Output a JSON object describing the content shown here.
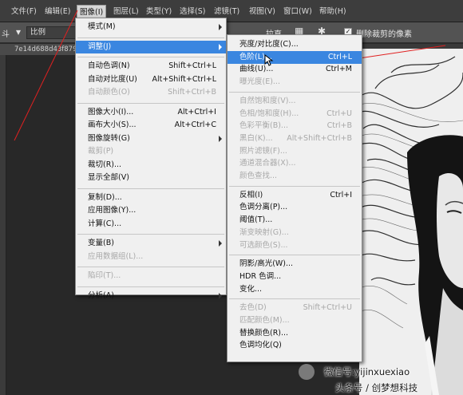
{
  "menubar": {
    "items": [
      "文件(F)",
      "编辑(E)",
      "图像(I)",
      "图层(L)",
      "类型(Y)",
      "选择(S)",
      "滤镜(T)",
      "视图(V)",
      "窗口(W)",
      "帮助(H)"
    ],
    "active_index": 2
  },
  "options": {
    "tool_label": "斗",
    "ratio_value": "比例",
    "straighten_label": "拉直",
    "delete_cropped_label": "删除裁剪的像素",
    "delete_cropped_checked": true
  },
  "tab": {
    "title": "7e14d688d43f879"
  },
  "image_menu": [
    {
      "type": "item",
      "label": "模式(M)",
      "shortcut": "",
      "submenu": true,
      "disabled": false,
      "highlighted": false
    },
    {
      "type": "sep"
    },
    {
      "type": "item",
      "label": "调整(J)",
      "shortcut": "",
      "submenu": true,
      "disabled": false,
      "highlighted": true
    },
    {
      "type": "sep"
    },
    {
      "type": "item",
      "label": "自动色调(N)",
      "shortcut": "Shift+Ctrl+L",
      "submenu": false,
      "disabled": false,
      "highlighted": false
    },
    {
      "type": "item",
      "label": "自动对比度(U)",
      "shortcut": "Alt+Shift+Ctrl+L",
      "submenu": false,
      "disabled": false,
      "highlighted": false
    },
    {
      "type": "item",
      "label": "自动颜色(O)",
      "shortcut": "Shift+Ctrl+B",
      "submenu": false,
      "disabled": true,
      "highlighted": false
    },
    {
      "type": "sep"
    },
    {
      "type": "item",
      "label": "图像大小(I)...",
      "shortcut": "Alt+Ctrl+I",
      "submenu": false,
      "disabled": false,
      "highlighted": false
    },
    {
      "type": "item",
      "label": "画布大小(S)...",
      "shortcut": "Alt+Ctrl+C",
      "submenu": false,
      "disabled": false,
      "highlighted": false
    },
    {
      "type": "item",
      "label": "图像旋转(G)",
      "shortcut": "",
      "submenu": true,
      "disabled": false,
      "highlighted": false
    },
    {
      "type": "item",
      "label": "裁剪(P)",
      "shortcut": "",
      "submenu": false,
      "disabled": true,
      "highlighted": false
    },
    {
      "type": "item",
      "label": "裁切(R)...",
      "shortcut": "",
      "submenu": false,
      "disabled": false,
      "highlighted": false
    },
    {
      "type": "item",
      "label": "显示全部(V)",
      "shortcut": "",
      "submenu": false,
      "disabled": false,
      "highlighted": false
    },
    {
      "type": "sep"
    },
    {
      "type": "item",
      "label": "复制(D)...",
      "shortcut": "",
      "submenu": false,
      "disabled": false,
      "highlighted": false
    },
    {
      "type": "item",
      "label": "应用图像(Y)...",
      "shortcut": "",
      "submenu": false,
      "disabled": false,
      "highlighted": false
    },
    {
      "type": "item",
      "label": "计算(C)...",
      "shortcut": "",
      "submenu": false,
      "disabled": false,
      "highlighted": false
    },
    {
      "type": "sep"
    },
    {
      "type": "item",
      "label": "变量(B)",
      "shortcut": "",
      "submenu": true,
      "disabled": false,
      "highlighted": false
    },
    {
      "type": "item",
      "label": "应用数据组(L)...",
      "shortcut": "",
      "submenu": false,
      "disabled": true,
      "highlighted": false
    },
    {
      "type": "sep"
    },
    {
      "type": "item",
      "label": "陷印(T)...",
      "shortcut": "",
      "submenu": false,
      "disabled": true,
      "highlighted": false
    },
    {
      "type": "sep"
    },
    {
      "type": "item",
      "label": "分析(A)",
      "shortcut": "",
      "submenu": true,
      "disabled": false,
      "highlighted": false
    }
  ],
  "adjust_menu": [
    {
      "type": "item",
      "label": "亮度/对比度(C)...",
      "shortcut": "",
      "disabled": false,
      "highlighted": false
    },
    {
      "type": "item",
      "label": "色阶(L)...",
      "shortcut": "Ctrl+L",
      "disabled": false,
      "highlighted": true
    },
    {
      "type": "item",
      "label": "曲线(U)...",
      "shortcut": "Ctrl+M",
      "disabled": false,
      "highlighted": false
    },
    {
      "type": "item",
      "label": "曝光度(E)...",
      "shortcut": "",
      "disabled": true,
      "highlighted": false
    },
    {
      "type": "sep"
    },
    {
      "type": "item",
      "label": "自然饱和度(V)...",
      "shortcut": "",
      "disabled": true,
      "highlighted": false
    },
    {
      "type": "item",
      "label": "色相/饱和度(H)...",
      "shortcut": "Ctrl+U",
      "disabled": true,
      "highlighted": false
    },
    {
      "type": "item",
      "label": "色彩平衡(B)...",
      "shortcut": "Ctrl+B",
      "disabled": true,
      "highlighted": false
    },
    {
      "type": "item",
      "label": "黑白(K)...",
      "shortcut": "Alt+Shift+Ctrl+B",
      "disabled": true,
      "highlighted": false
    },
    {
      "type": "item",
      "label": "照片滤镜(F)...",
      "shortcut": "",
      "disabled": true,
      "highlighted": false
    },
    {
      "type": "item",
      "label": "通道混合器(X)...",
      "shortcut": "",
      "disabled": true,
      "highlighted": false
    },
    {
      "type": "item",
      "label": "颜色查找...",
      "shortcut": "",
      "disabled": true,
      "highlighted": false
    },
    {
      "type": "sep"
    },
    {
      "type": "item",
      "label": "反相(I)",
      "shortcut": "Ctrl+I",
      "disabled": false,
      "highlighted": false
    },
    {
      "type": "item",
      "label": "色调分离(P)...",
      "shortcut": "",
      "disabled": false,
      "highlighted": false
    },
    {
      "type": "item",
      "label": "阈值(T)...",
      "shortcut": "",
      "disabled": false,
      "highlighted": false
    },
    {
      "type": "item",
      "label": "渐变映射(G)...",
      "shortcut": "",
      "disabled": true,
      "highlighted": false
    },
    {
      "type": "item",
      "label": "可选颜色(S)...",
      "shortcut": "",
      "disabled": true,
      "highlighted": false
    },
    {
      "type": "sep"
    },
    {
      "type": "item",
      "label": "阴影/高光(W)...",
      "shortcut": "",
      "disabled": false,
      "highlighted": false
    },
    {
      "type": "item",
      "label": "HDR 色调...",
      "shortcut": "",
      "disabled": false,
      "highlighted": false
    },
    {
      "type": "item",
      "label": "变化...",
      "shortcut": "",
      "disabled": false,
      "highlighted": false
    },
    {
      "type": "sep"
    },
    {
      "type": "item",
      "label": "去色(D)",
      "shortcut": "Shift+Ctrl+U",
      "disabled": true,
      "highlighted": false
    },
    {
      "type": "item",
      "label": "匹配颜色(M)...",
      "shortcut": "",
      "disabled": true,
      "highlighted": false
    },
    {
      "type": "item",
      "label": "替换颜色(R)...",
      "shortcut": "",
      "disabled": false,
      "highlighted": false
    },
    {
      "type": "item",
      "label": "色调均化(Q)",
      "shortcut": "",
      "disabled": false,
      "highlighted": false
    }
  ],
  "watermark": {
    "line1": "微信号:yijinxuexiao",
    "line2": "头条号 / 创梦想科技"
  },
  "colors": {
    "highlight": "#3a86e0",
    "annotation": "#e02020"
  }
}
